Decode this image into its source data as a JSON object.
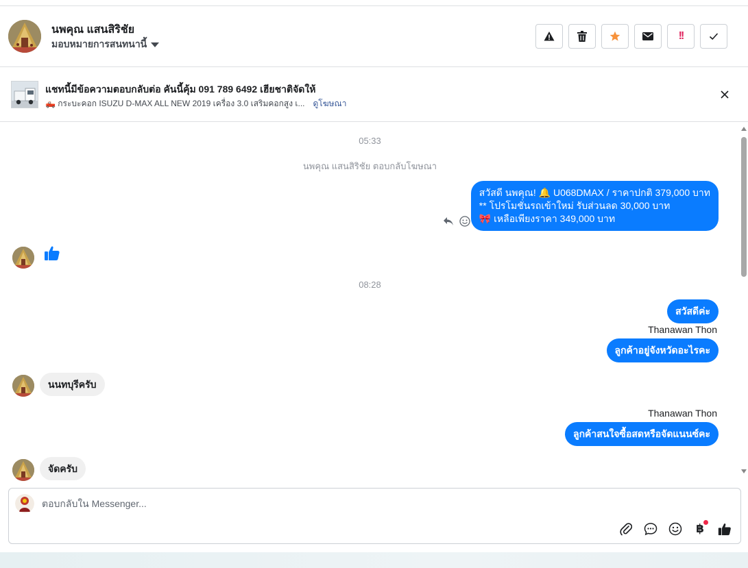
{
  "header": {
    "contact_name": "นพคุณ แสนสิริชัย",
    "assign_label": "มอบหมายการสนทนานี้",
    "actions": [
      "spam-report",
      "delete",
      "star",
      "mark-unread",
      "important",
      "done"
    ]
  },
  "ad": {
    "title": "แชทนี้มีข้อความตอบกลับต่อ คันนี้คุ้ม 091 789 6492 เฮียชาติจัดให้",
    "subtitle": "🛻 กระบะคอก ISUZU D-MAX ALL NEW 2019 เครื่อง 3.0 เสริมคอกสูง เ...",
    "link_label": "ดูโฆษณา"
  },
  "messages": {
    "time1": "05:33",
    "system1": "นพคุณ แสนสิริชัย ตอบกลับโฆษณา",
    "out1_line1": "สวัสดี นพคุณ! 🔔 U068DMAX / ราคาปกติ 379,000 บาท",
    "out1_line2": "** โปรโมชั่นรถเข้าใหม่ รับส่วนลด 30,000 บาท",
    "out1_line3": "🎀 เหลือเพียงราคา 349,000 บาท",
    "time2": "08:28",
    "out2": "สวัสดีค่ะ",
    "sender1": "Thanawan Thon",
    "out3": "ลูกค้าอยู่จังหวัดอะไรคะ",
    "in1": "นนทบุรีครับ",
    "sender2": "Thanawan Thon",
    "out4": "ลูกค้าสนใจซื้อสดหรือจัดแนนซ์คะ",
    "in2": "จัดครับ"
  },
  "composer": {
    "placeholder": "ตอบกลับใน Messenger...",
    "currency_symbol": "฿"
  },
  "colors": {
    "bubble_out": "#0a7cff",
    "bubble_in": "#f0f0f0",
    "link": "#385898",
    "star": "#f7923b",
    "important": "#e0245e"
  }
}
